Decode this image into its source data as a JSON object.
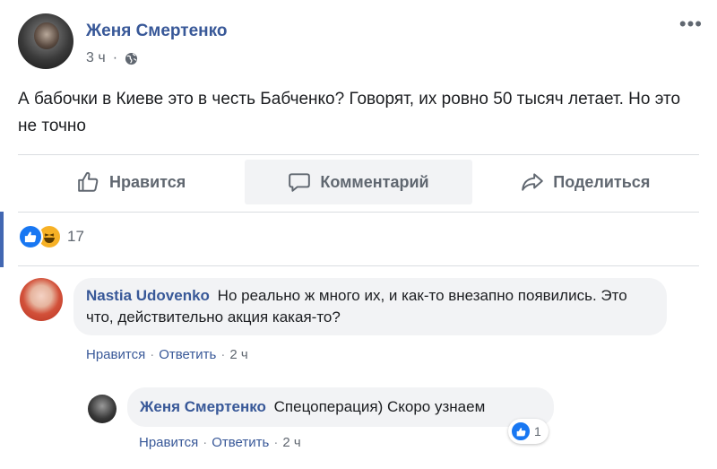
{
  "post": {
    "author": "Женя Смертенко",
    "time": "3 ч",
    "privacy_icon": "globe-icon",
    "more_label": "•••",
    "text": "А бабочки в Киеве это в честь Бабченко? Говорят, их ровно 50 тысяч летает. Но это не точно"
  },
  "actions": {
    "like": "Нравится",
    "comment": "Комментарий",
    "share": "Поделиться"
  },
  "reactions": {
    "types": [
      "like",
      "haha"
    ],
    "count": "17"
  },
  "comments": [
    {
      "author": "Nastia Udovenko",
      "text": "Но реально ж много их, и как-то внезапно появились. Это что, действительно акция какая-то?",
      "like_label": "Нравится",
      "reply_label": "Ответить",
      "time": "2 ч"
    },
    {
      "author": "Женя Смертенко",
      "text": "Спецоперация) Скоро узнаем",
      "like_label": "Нравится",
      "reply_label": "Ответить",
      "time": "2 ч",
      "reaction_count": "1"
    }
  ],
  "colors": {
    "link": "#385898",
    "like_blue": "#1877f2",
    "haha_yellow": "#f7b125",
    "muted": "#606770",
    "bubble": "#f2f3f5"
  }
}
